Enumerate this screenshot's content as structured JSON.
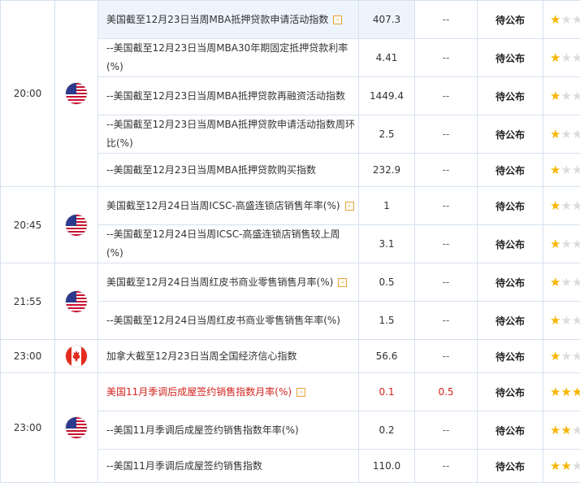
{
  "rows": [
    {
      "time": "20:00",
      "flag": "us",
      "name": "美国截至12月23日当周MBA抵押贷款申请活动指数",
      "tag": "-",
      "actual": "407.3",
      "forecast": "--",
      "prev": "待公布",
      "stars": 1
    },
    {
      "name": "--美国截至12月23日当周MBA30年期固定抵押贷款利率(%)",
      "actual": "4.41",
      "forecast": "--",
      "prev": "待公布",
      "stars": 1
    },
    {
      "name": "--美国截至12月23日当周MBA抵押贷款再融资活动指数",
      "actual": "1449.4",
      "forecast": "--",
      "prev": "待公布",
      "stars": 1
    },
    {
      "name": "--美国截至12月23日当周MBA抵押贷款申请活动指数周环比(%)",
      "actual": "2.5",
      "forecast": "--",
      "prev": "待公布",
      "stars": 1
    },
    {
      "name": "--美国截至12月23日当周MBA抵押贷款购买指数",
      "actual": "232.9",
      "forecast": "--",
      "prev": "待公布",
      "stars": 1
    },
    {
      "time": "20:45",
      "flag": "us",
      "name": "美国截至12月24日当周ICSC-高盛连锁店销售年率(%)",
      "tag": "-",
      "actual": "1",
      "forecast": "--",
      "prev": "待公布",
      "stars": 1
    },
    {
      "name": "--美国截至12月24日当周ICSC-高盛连锁店销售较上周(%)",
      "actual": "3.1",
      "forecast": "--",
      "prev": "待公布",
      "stars": 1
    },
    {
      "time": "21:55",
      "flag": "us",
      "name": "美国截至12月24日当周红皮书商业零售销售月率(%)",
      "tag": "-",
      "actual": "0.5",
      "forecast": "--",
      "prev": "待公布",
      "stars": 1
    },
    {
      "name": "--美国截至12月24日当周红皮书商业零售销售年率(%)",
      "actual": "1.5",
      "forecast": "--",
      "prev": "待公布",
      "stars": 1
    },
    {
      "time": "23:00",
      "flag": "ca",
      "name": "加拿大截至12月23日当周全国经济信心指数",
      "actual": "56.6",
      "forecast": "--",
      "prev": "待公布",
      "stars": 1
    },
    {
      "time": "23:00",
      "flag": "us",
      "name": "美国11月季调后成屋签约销售指数月率(%)",
      "tag": "-",
      "actual": "0.1",
      "forecast": "0.5",
      "prev": "待公布",
      "stars": 3
    },
    {
      "name": "--美国11月季调后成屋签约销售指数年率(%)",
      "actual": "0.2",
      "forecast": "--",
      "prev": "待公布",
      "stars": 2
    },
    {
      "name": "--美国11月季调后成屋签约销售指数",
      "actual": "110.0",
      "forecast": "--",
      "prev": "待公布",
      "stars": 2
    }
  ],
  "colors": {
    "star_on": "#f7b500",
    "star_off": "#dcdcdc",
    "highlight": "#d2231e",
    "border": "#d6e2ee"
  }
}
